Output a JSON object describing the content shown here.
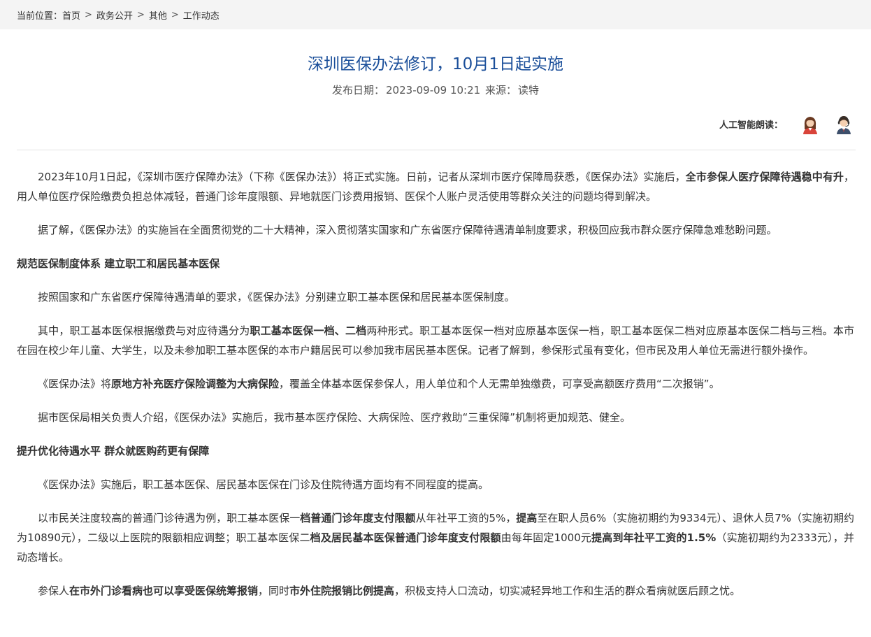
{
  "breadcrumb": {
    "label": "当前位置：",
    "items": [
      "首页",
      "政务公开",
      "其他",
      "工作动态"
    ],
    "separator": ">"
  },
  "article": {
    "title": "深圳医保办法修订，10月1日起实施",
    "date_label": "发布日期：",
    "date": "2023-09-09 10:21",
    "source_label": "来源：",
    "source": "读特"
  },
  "tts": {
    "label": "人工智能朗读：",
    "female_icon": "female-reader-icon",
    "male_icon": "male-reader-icon"
  },
  "paragraphs": [
    [
      {
        "t": "2023年10月1日起，《深圳市医疗保障办法》（下称《医保办法》）将正式实施。日前，记者从深圳市医疗保障局获悉，《医保办法》实施后，"
      },
      {
        "t": "全市参保人医疗保障待遇稳中有升",
        "b": true
      },
      {
        "t": "，用人单位医疗保险缴费负担总体减轻，普通门诊年度限额、异地就医门诊费用报销、医保个人账户灵活使用等群众关注的问题均得到解决。"
      }
    ],
    [
      {
        "t": "据了解，《医保办法》的实施旨在全面贯彻党的二十大精神，深入贯彻落实国家和广东省医疗保障待遇清单制度要求，积极回应我市群众医疗保障急难愁盼问题。"
      }
    ],
    {
      "heading": "规范医保制度体系 建立职工和居民基本医保"
    },
    [
      {
        "t": "按照国家和广东省医疗保障待遇清单的要求，《医保办法》分别建立职工基本医保和居民基本医保制度。"
      }
    ],
    [
      {
        "t": "其中，职工基本医保根据缴费与对应待遇分为"
      },
      {
        "t": "职工基本医保一档、二档",
        "b": true
      },
      {
        "t": "两种形式。职工基本医保一档对应原基本医保一档，职工基本医保二档对应原基本医保二档与三档。本市在园在校少年儿童、大学生，以及未参加职工基本医保的本市户籍居民可以参加我市居民基本医保。记者了解到，参保形式虽有变化，但市民及用人单位无需进行额外操作。"
      }
    ],
    [
      {
        "t": "《医保办法》将"
      },
      {
        "t": "原地方补充医疗保险调整为大病保险",
        "b": true
      },
      {
        "t": "，覆盖全体基本医保参保人，用人单位和个人无需单独缴费，可享受高额医疗费用“二次报销”。"
      }
    ],
    [
      {
        "t": "据市医保局相关负责人介绍，《医保办法》实施后，我市基本医疗保险、大病保险、医疗救助“三重保障”机制将更加规范、健全。"
      }
    ],
    {
      "heading": "提升优化待遇水平 群众就医购药更有保障"
    },
    [
      {
        "t": "《医保办法》实施后，职工基本医保、居民基本医保在门诊及住院待遇方面均有不同程度的提高。"
      }
    ],
    [
      {
        "t": "以市民关注度较高的普通门诊待遇为例，职工基本医保一"
      },
      {
        "t": "档普通门诊年度支付限额",
        "b": true
      },
      {
        "t": "从年社平工资的5%，"
      },
      {
        "t": "提高",
        "b": true
      },
      {
        "t": "至在职人员6%（实施初期约为9334元）、退休人员7%（实施初期约为10890元），二级以上医院的限额相应调整；职工基本医保二"
      },
      {
        "t": "档及居民基本医保普通门诊年度支付限额",
        "b": true
      },
      {
        "t": "由每年固定1000元"
      },
      {
        "t": "提高到年社平工资的1.5%",
        "b": true
      },
      {
        "t": "（实施初期约为2333元），并动态增长。"
      }
    ],
    [
      {
        "t": "参保人"
      },
      {
        "t": "在市外门诊看病也可以享受医保统筹报销",
        "b": true
      },
      {
        "t": "，同时"
      },
      {
        "t": "市外住院报销比例提高",
        "b": true
      },
      {
        "t": "，积极支持人口流动，切实减轻异地工作和生活的群众看病就医后顾之忧。"
      }
    ]
  ]
}
